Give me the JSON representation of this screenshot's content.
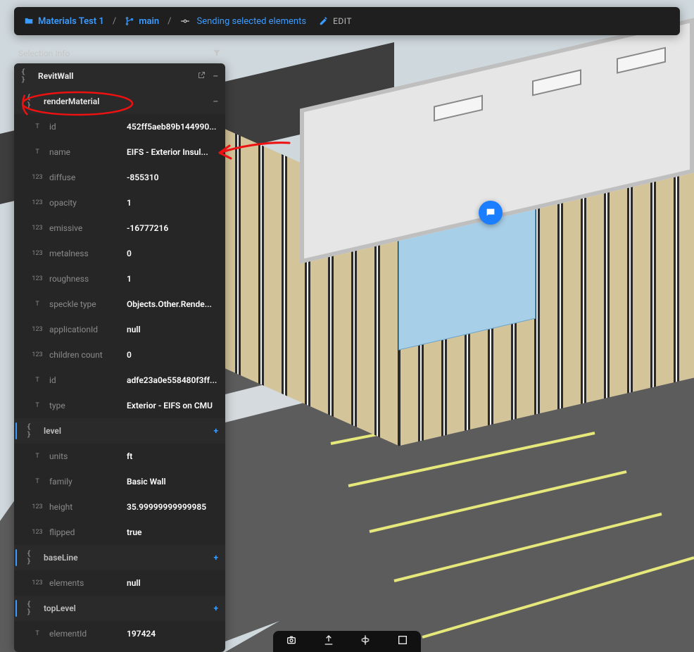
{
  "topbar": {
    "project": "Materials Test 1",
    "branch": "main",
    "status": "Sending selected elements",
    "edit": "EDIT"
  },
  "panel": {
    "title": "Selection Info",
    "object_type": "RevitWall",
    "render_material": {
      "label": "renderMaterial",
      "id": "452ff5aeb89b144990...",
      "name": "EIFS - Exterior Insul...",
      "diffuse": "-855310",
      "opacity": "1",
      "emissive": "-16777216",
      "metalness": "0",
      "roughness": "1",
      "speckle_type": "Objects.Other.Rende...",
      "applicationId": "null",
      "children_count": "0"
    },
    "props": {
      "id": "adfe23a0e558480f3ff...",
      "type": "Exterior - EIFS on CMU",
      "level_label": "level",
      "units": "ft",
      "family": "Basic Wall",
      "height": "35.99999999999985",
      "flipped": "true",
      "baseLine_label": "baseLine",
      "elements": "null",
      "topLevel_label": "topLevel",
      "elementId": "197424"
    }
  }
}
